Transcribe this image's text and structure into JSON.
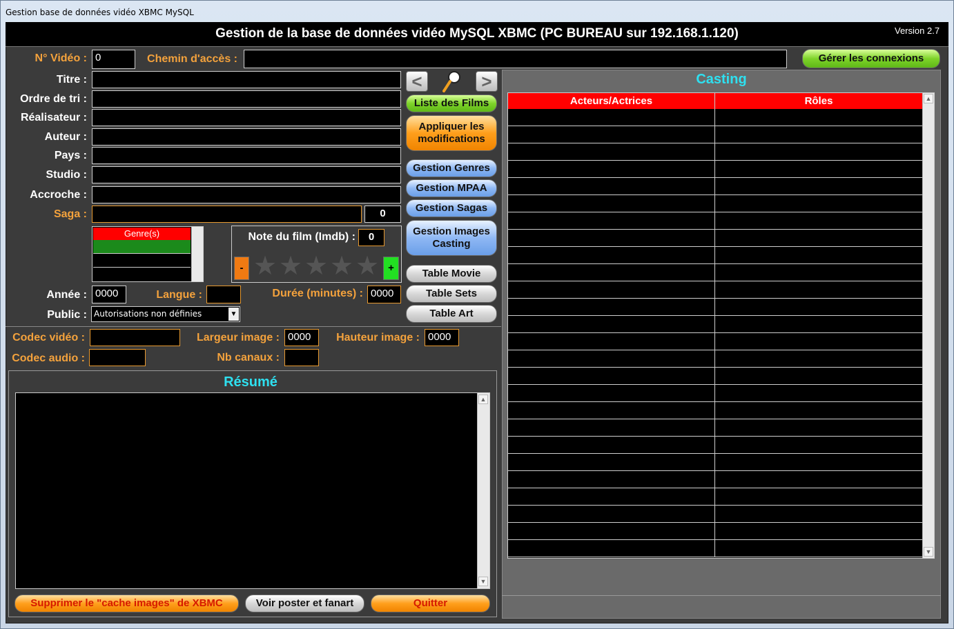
{
  "window": {
    "title": "Gestion base de données vidéo XBMC MySQL"
  },
  "header": {
    "title": "Gestion de la base de données vidéo MySQL XBMC (PC BUREAU sur 192.168.1.120)",
    "version": "Version 2.7"
  },
  "video": {
    "no_label": "N° Vidéo :",
    "no_value": "0",
    "path_label": "Chemin d'accès :",
    "path_value": "",
    "manage_connections": "Gérer les connexions"
  },
  "fields": {
    "titre": "Titre :",
    "ordre": "Ordre de tri :",
    "realisateur": "Réalisateur :",
    "auteur": "Auteur :",
    "pays": "Pays :",
    "studio": "Studio :",
    "accroche": "Accroche :",
    "saga": "Saga :",
    "saga_count": "0",
    "annee": "Année :",
    "annee_value": "0000",
    "langue": "Langue :",
    "duree": "Durée (minutes) :",
    "duree_value": "0000",
    "public": "Public :",
    "public_value": "Autorisations non définies"
  },
  "genres": {
    "header": "Genre(s)"
  },
  "rating": {
    "label": "Note du film (Imdb) :",
    "value": "0",
    "minus": "-",
    "plus": "+",
    "stars": 0
  },
  "nav": {
    "prev": "<",
    "next": ">"
  },
  "buttons": {
    "liste_films": "Liste des Films",
    "appliquer": "Appliquer les modifications",
    "gestion_genres": "Gestion Genres",
    "gestion_mpaa": "Gestion MPAA",
    "gestion_sagas": "Gestion Sagas",
    "gestion_images": "Gestion Images Casting",
    "table_movie": "Table Movie",
    "table_sets": "Table Sets",
    "table_art": "Table Art",
    "supprimer_cache": "Supprimer le \"cache images\" de XBMC",
    "voir_poster": "Voir poster et fanart",
    "quitter": "Quitter"
  },
  "tech": {
    "codec_video": "Codec vidéo :",
    "codec_audio": "Codec audio :",
    "largeur": "Largeur image :",
    "largeur_value": "0000",
    "hauteur": "Hauteur image :",
    "hauteur_value": "0000",
    "nb_canaux": "Nb canaux :"
  },
  "resume": {
    "title": "Résumé",
    "text": ""
  },
  "casting": {
    "title": "Casting",
    "col_actors": "Acteurs/Actrices",
    "col_roles": "Rôles",
    "row_count": 26
  },
  "colors": {
    "accent_orange": "#f4a23c",
    "title_cyan": "#2ee0f0",
    "header_red": "#ff0000",
    "genre_green": "#1b8a1b"
  }
}
